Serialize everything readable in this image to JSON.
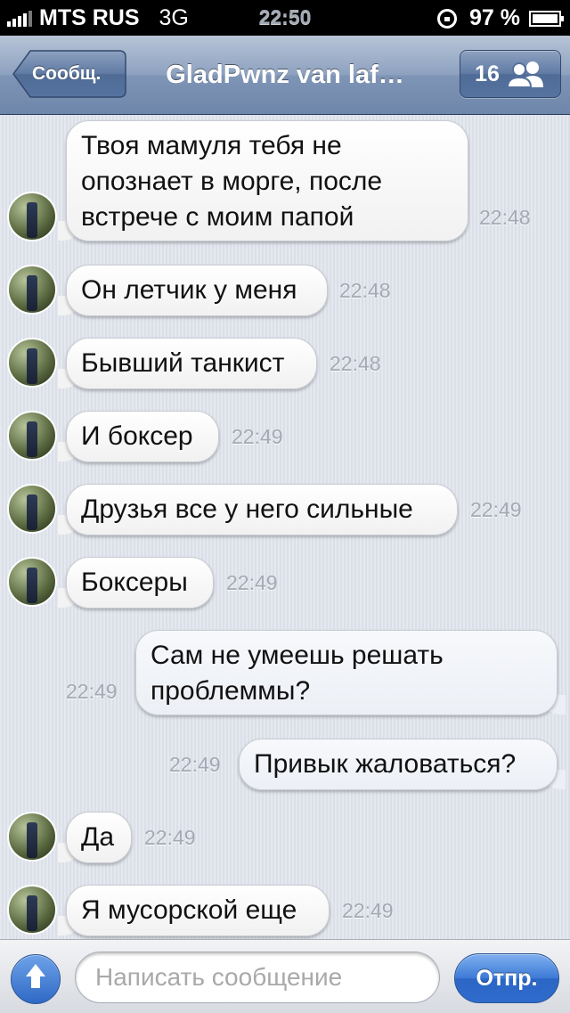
{
  "status_bar": {
    "carrier": "MTS RUS",
    "network": "3G",
    "time": "22:50",
    "battery": "97 %",
    "icons": [
      "signal-icon",
      "rotation-lock-icon",
      "battery-icon"
    ]
  },
  "nav": {
    "back_label": "Сообщ.",
    "title": "GladPwnz van laf…",
    "participants_count": "16",
    "participants_icon": "group-people-icon"
  },
  "messages": [
    {
      "direction": "incoming",
      "text_lines": [
        "Твоя мамуля тебя не",
        "опознает в морге, после",
        "встрече с моим папой"
      ],
      "time": "22:48"
    },
    {
      "direction": "incoming",
      "text_lines": [
        "Он летчик у меня"
      ],
      "time": "22:48"
    },
    {
      "direction": "incoming",
      "text_lines": [
        "Бывший танкист"
      ],
      "time": "22:48"
    },
    {
      "direction": "incoming",
      "text_lines": [
        "И боксер"
      ],
      "time": "22:49"
    },
    {
      "direction": "incoming",
      "text_lines": [
        "Друзья все у него сильные"
      ],
      "time": "22:49"
    },
    {
      "direction": "incoming",
      "text_lines": [
        "Боксеры"
      ],
      "time": "22:49"
    },
    {
      "direction": "outgoing",
      "text_lines": [
        "Сам не умеешь решать",
        "проблеммы?"
      ],
      "time": "22:49"
    },
    {
      "direction": "outgoing",
      "text_lines": [
        "Привык жаловаться?"
      ],
      "time": "22:49"
    },
    {
      "direction": "incoming",
      "text_lines": [
        "Да"
      ],
      "time": "22:49"
    },
    {
      "direction": "incoming",
      "text_lines": [
        "Я мусорской еще"
      ],
      "time": "22:49"
    }
  ],
  "composer": {
    "placeholder": "Написать сообщение",
    "value": "",
    "send_label": "Отпр.",
    "attach_icon": "upload-arrow-icon"
  },
  "colors": {
    "nav_blue": "#7f95b6",
    "send_blue": "#3d7ad7",
    "background": "#dfe3ec",
    "timestamp": "#a3a9b5"
  }
}
